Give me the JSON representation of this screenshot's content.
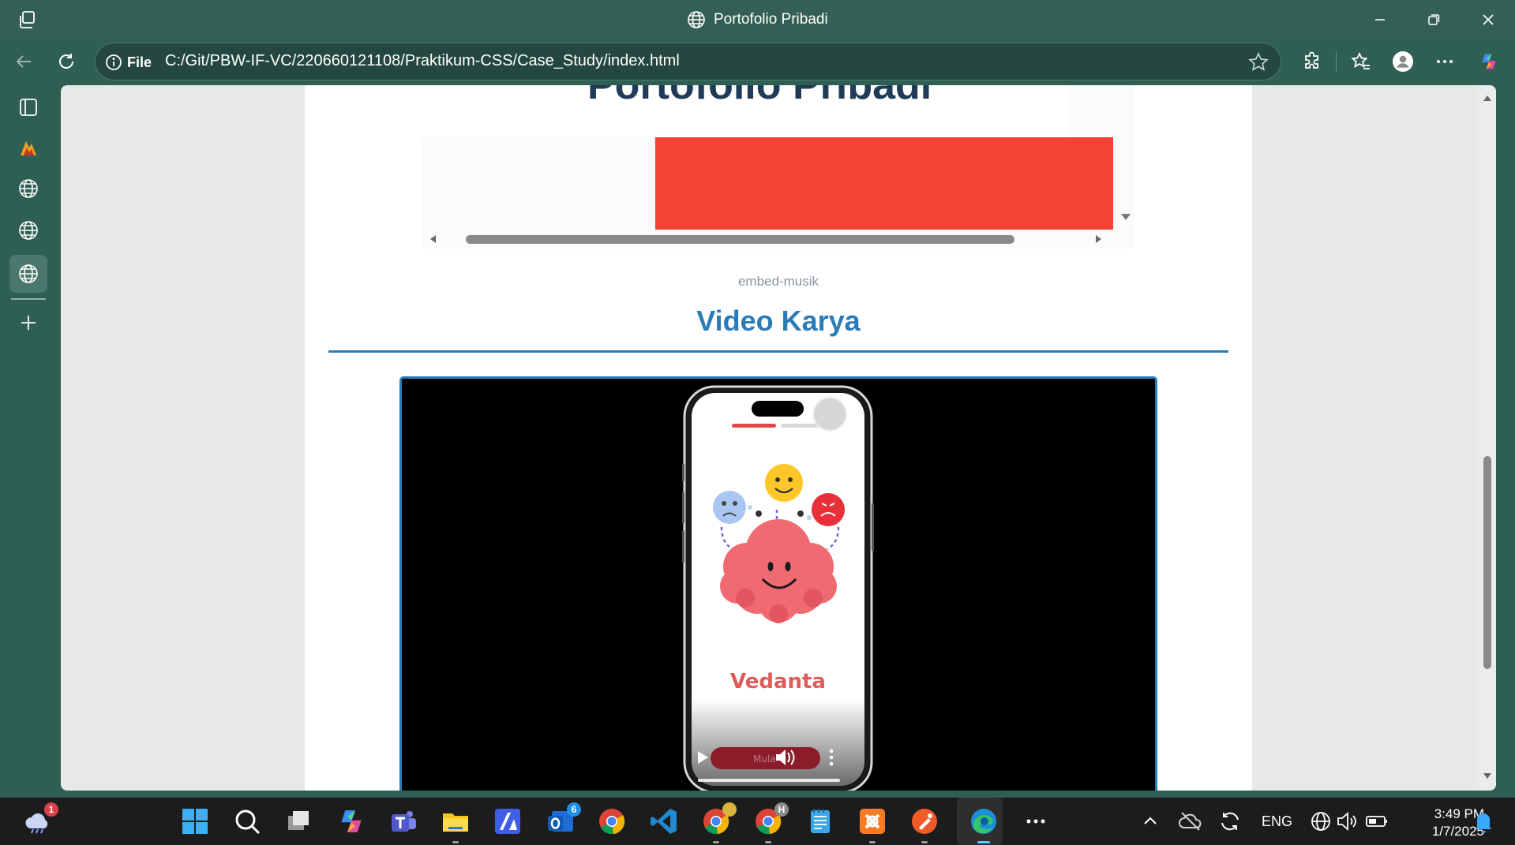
{
  "window": {
    "title": "Portofolio Pribadi"
  },
  "addressbar": {
    "protocol_label": "File",
    "url": "C:/Git/PBW-IF-VC/220660121108/Praktikum-CSS/Case_Study/index.html"
  },
  "page": {
    "music_heading_partial": "Portofolio Pribadi",
    "embed_caption": "embed-musik",
    "section_title": "Video Karya",
    "video": {
      "app_name": "Vedanta",
      "control_text": "Mula"
    }
  },
  "taskbar": {
    "weather_badge": "1",
    "outlook_badge": "6",
    "chrome_profile_h": "H",
    "language": "ENG",
    "time": "3:49 PM",
    "date": "1/7/2025"
  },
  "colors": {
    "titlebar": "#335f54",
    "accent": "#2a7cb8",
    "red_block": "#f44336",
    "app_name": "#e05a5a"
  }
}
